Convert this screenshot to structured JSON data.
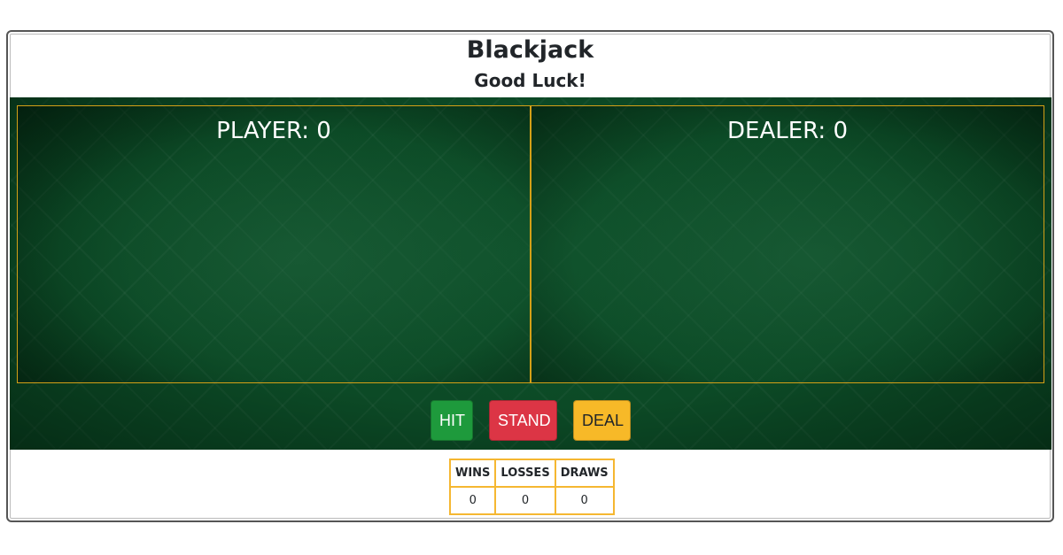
{
  "header": {
    "title": "Blackjack",
    "subtitle": "Good Luck!"
  },
  "player": {
    "label": "PLAYER: 0"
  },
  "dealer": {
    "label": "DEALER: 0"
  },
  "controls": {
    "hit_label": "HIT",
    "stand_label": "STAND",
    "deal_label": "DEAL"
  },
  "scoreboard": {
    "headers": [
      "WINS",
      "LOSSES",
      "DRAWS"
    ],
    "values": [
      "0",
      "0",
      "0"
    ]
  },
  "colors": {
    "felt": "#0c4a26",
    "border_gold": "#d4a017",
    "hit": "#1e9a3c",
    "stand": "#dc3545",
    "deal": "#f7b928",
    "table_border": "#f5b731"
  }
}
